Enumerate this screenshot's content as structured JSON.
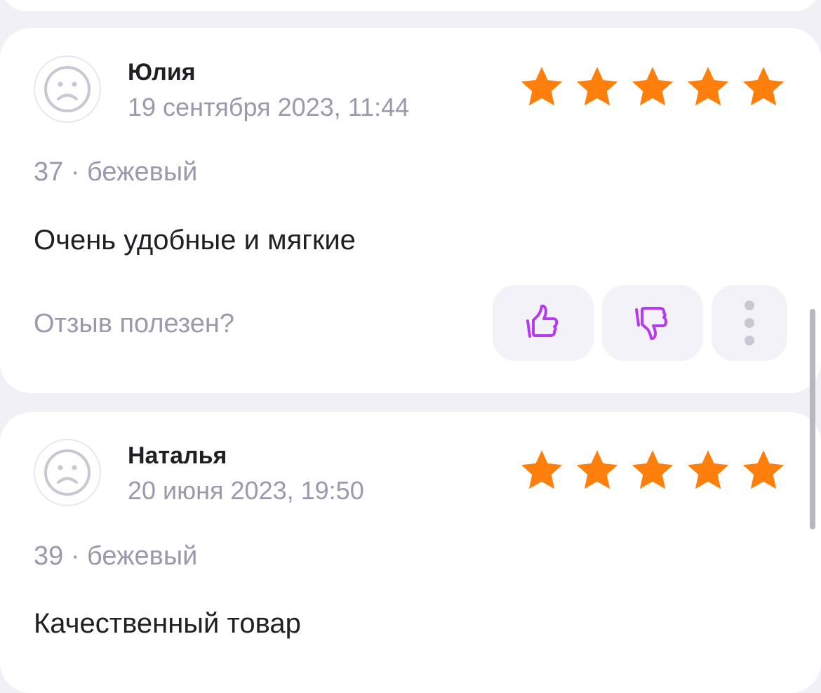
{
  "colors": {
    "star": "#ff7f0c",
    "accent_icon": "#b43bf0",
    "muted_text": "#9b99ab",
    "background": "#f1f0f6"
  },
  "reviews": [
    {
      "author": "Юлия",
      "date": "19 сентября 2023, 11:44",
      "rating": 5,
      "variant": "37 · бежевый",
      "text": "Очень удобные и мягкие",
      "helpful_prompt": "Отзыв полезен?",
      "avatar_icon": "sad-face-icon",
      "like_icon": "thumb-up-icon",
      "dislike_icon": "thumb-down-icon",
      "more_icon": "more-vertical-icon"
    },
    {
      "author": "Наталья",
      "date": "20 июня 2023, 19:50",
      "rating": 5,
      "variant": "39 · бежевый",
      "text": "Качественный товар",
      "avatar_icon": "sad-face-icon"
    }
  ]
}
